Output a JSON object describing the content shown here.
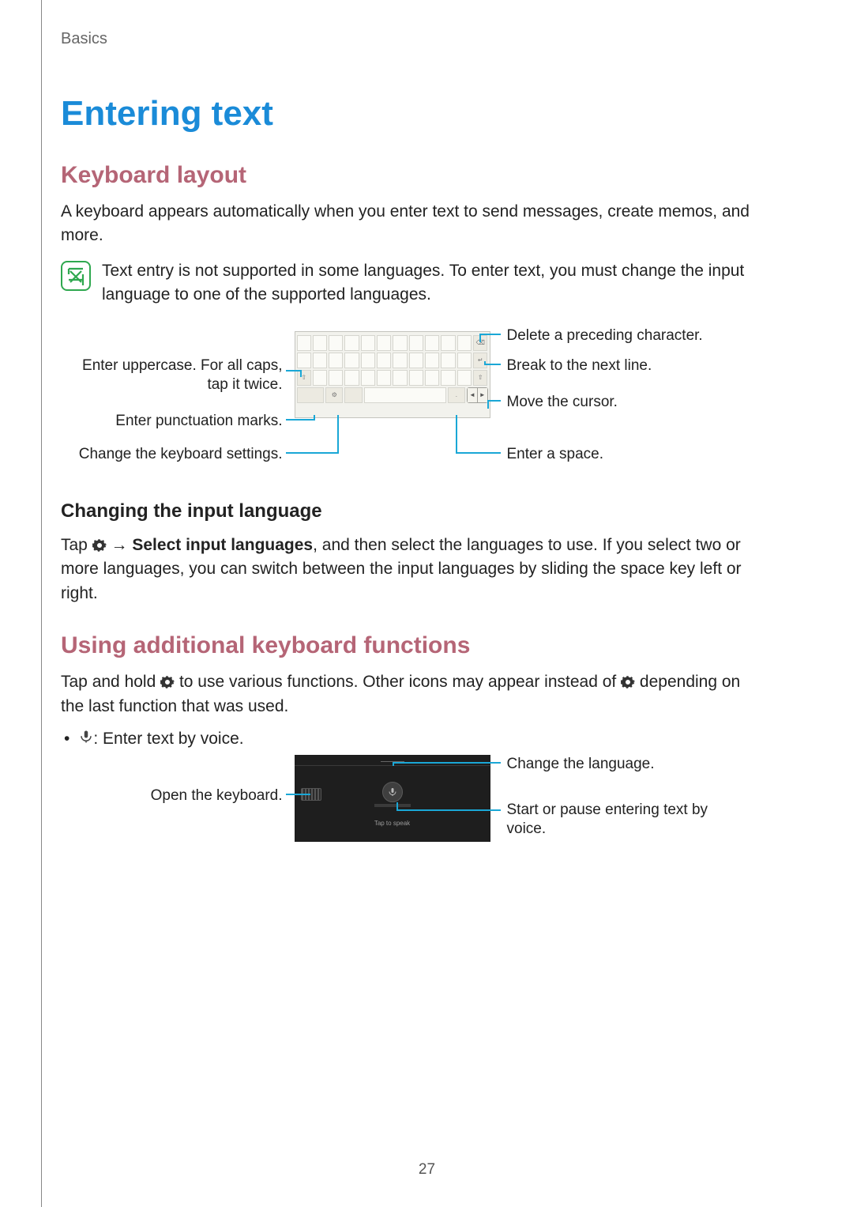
{
  "breadcrumb": "Basics",
  "h1": "Entering text",
  "h2_keyboard": "Keyboard layout",
  "p_intro": "A keyboard appears automatically when you enter text to send messages, create memos, and more.",
  "note_text": "Text entry is not supported in some languages. To enter text, you must change the input language to one of the supported languages.",
  "kb_labels": {
    "uppercase": "Enter uppercase. For all caps,\ntap it twice.",
    "punctuation": "Enter punctuation marks.",
    "settings": "Change the keyboard settings.",
    "delete": "Delete a preceding character.",
    "break": "Break to the next line.",
    "cursor": "Move the cursor.",
    "space": "Enter a space."
  },
  "h3_changing": "Changing the input language",
  "changing_tap": "Tap ",
  "changing_arrow": " → ",
  "changing_bold": "Select input languages",
  "changing_rest": ", and then select the languages to use. If you select two or more languages, you can switch between the input languages by sliding the space key left or right.",
  "h2_additional": "Using additional keyboard functions",
  "additional_pre": "Tap and hold ",
  "additional_mid": " to use various functions. Other icons may appear instead of ",
  "additional_post": " depending on the last function that was used.",
  "bullet_voice": " : Enter text by voice.",
  "voice_labels": {
    "open_kb": "Open the keyboard.",
    "change_lang": "Change the language.",
    "start_pause": "Start or pause entering text by voice."
  },
  "voice_tap": "Tap to speak",
  "page_number": "27"
}
